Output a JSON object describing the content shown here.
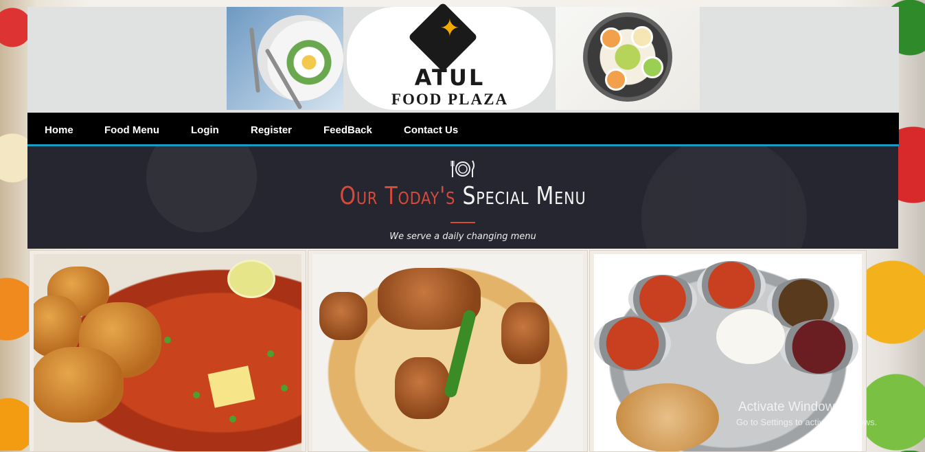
{
  "logo": {
    "title": "ATUL",
    "subtitle": "FOOD PLAZA"
  },
  "nav": {
    "items": [
      {
        "label": "Home"
      },
      {
        "label": "Food Menu"
      },
      {
        "label": "Login"
      },
      {
        "label": "Register"
      },
      {
        "label": "FeedBack"
      },
      {
        "label": "Contact Us"
      }
    ],
    "accent_color": "#1a9bc6"
  },
  "banner": {
    "title_accent": "Our Today's",
    "title_main": "Special Menu",
    "subtitle": "We serve a daily changing menu",
    "accent_color": "#d64a3a"
  },
  "gallery": {
    "items": [
      {
        "icon": "pav-bhaji-photo"
      },
      {
        "icon": "biryani-photo"
      },
      {
        "icon": "thali-photo"
      }
    ]
  },
  "watermark": {
    "title": "Activate Windows",
    "subtitle": "Go to Settings to activate Windows."
  }
}
